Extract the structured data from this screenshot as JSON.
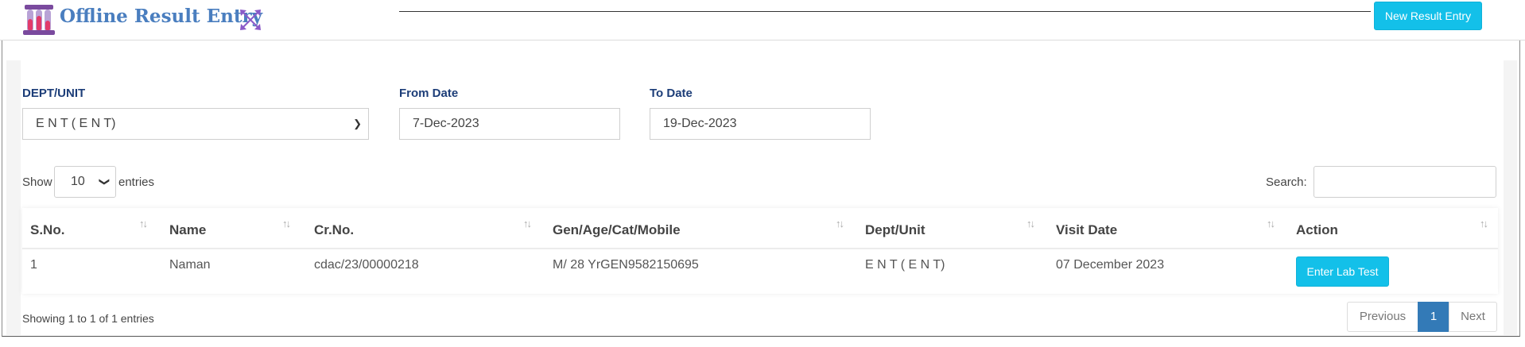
{
  "header": {
    "title": "Offline Result Entry",
    "logo_icon": "test-tubes-icon",
    "expand_icon": "expand-arrows-icon",
    "new_button_label": "New Result Entry"
  },
  "filters": {
    "dept_label": "DEPT/UNIT",
    "dept_value": "E N T ( E N T)",
    "from_label": "From Date",
    "from_value": "7-Dec-2023",
    "to_label": "To Date",
    "to_value": "19-Dec-2023"
  },
  "table_controls": {
    "show_label": "Show",
    "entries_value": "10",
    "entries_label": "entries",
    "search_label": "Search:",
    "search_value": ""
  },
  "table": {
    "columns": [
      "S.No.",
      "Name",
      "Cr.No.",
      "Gen/Age/Cat/Mobile",
      "Dept/Unit",
      "Visit Date",
      "Action"
    ],
    "rows": [
      {
        "sno": "1",
        "name": "Naman",
        "crno": "cdac/23/00000218",
        "gen": "M/ 28 YrGEN9582150695",
        "dept": "E N T ( E N T)",
        "visit": "07 December 2023",
        "action": "Enter Lab Test"
      }
    ]
  },
  "footer": {
    "info": "Showing 1 to 1 of 1 entries",
    "previous": "Previous",
    "page": "1",
    "next": "Next"
  },
  "colors": {
    "accent": "#13c0e9",
    "title": "#4a7ebf",
    "label": "#1c3d78",
    "page_active": "#337ab7"
  }
}
